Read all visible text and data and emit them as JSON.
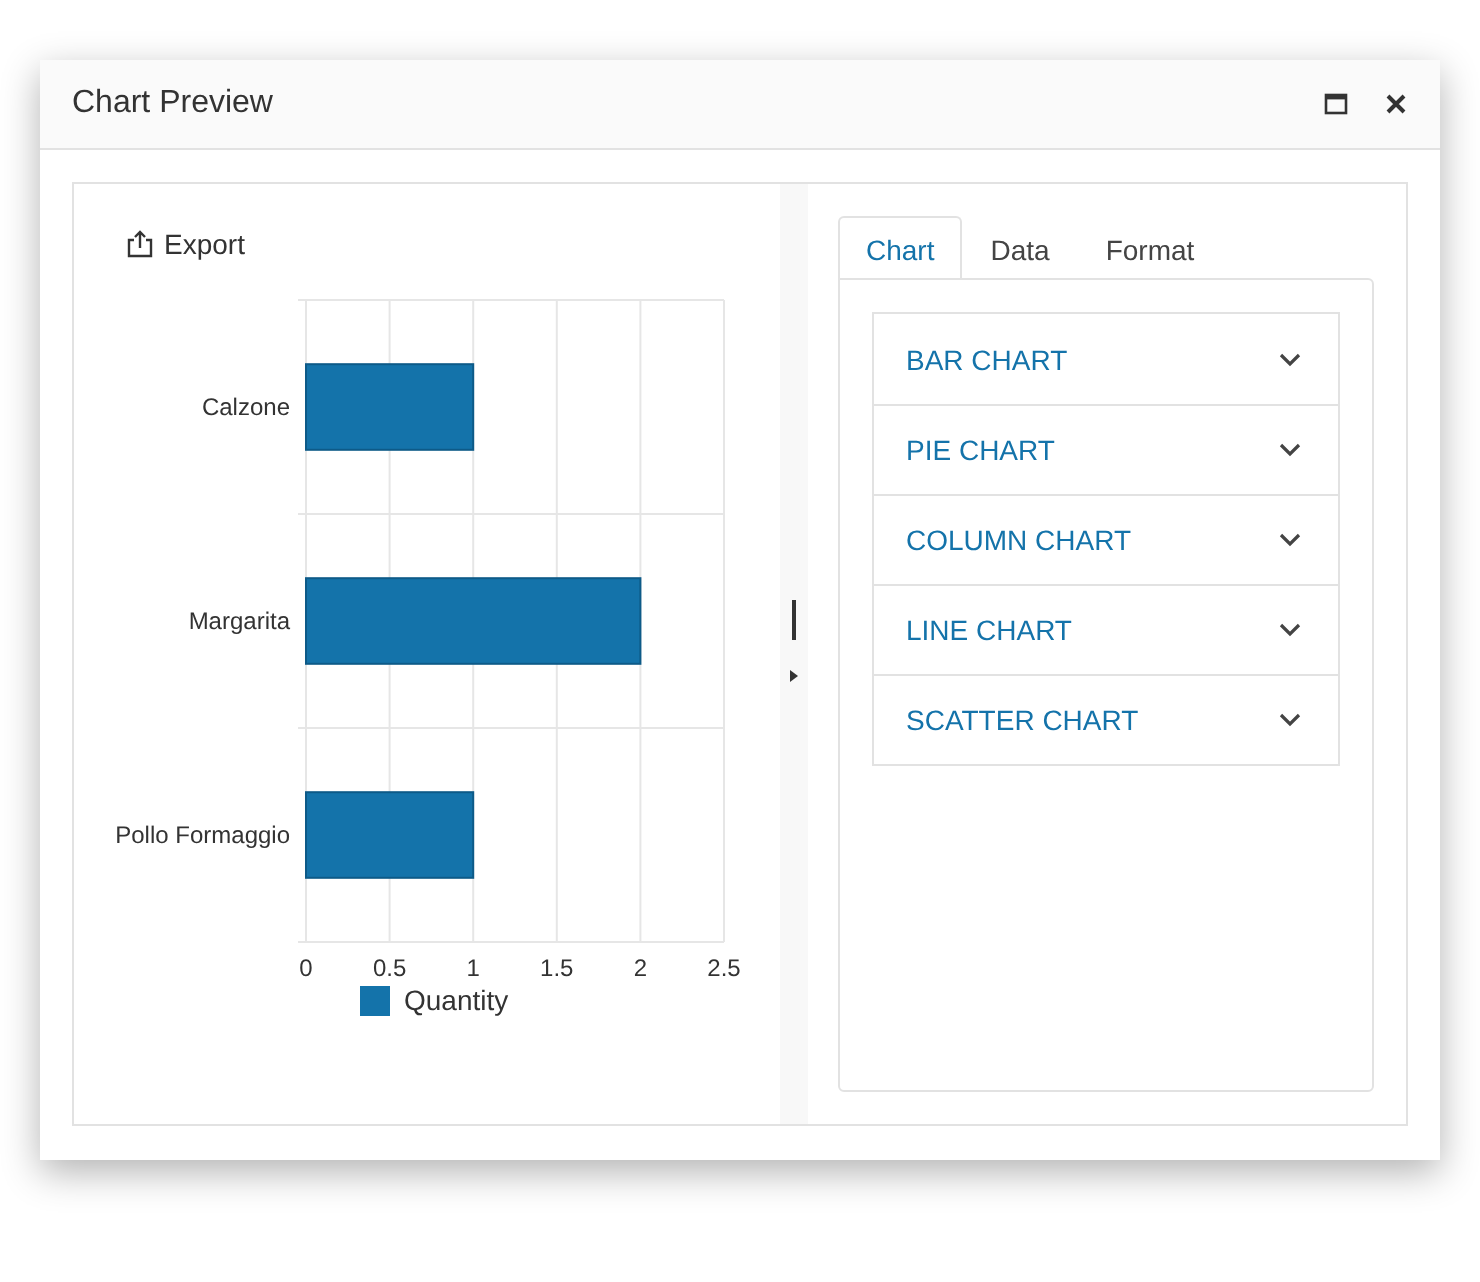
{
  "window": {
    "title": "Chart Preview"
  },
  "toolbar": {
    "export_label": "Export"
  },
  "chart": {
    "chart_data": {
      "type": "bar",
      "orientation": "horizontal",
      "grid": true,
      "categories": [
        "Calzone",
        "Margarita",
        "Pollo Formaggio"
      ],
      "series": [
        {
          "name": "Quantity",
          "color": "#1473aa",
          "values": [
            1,
            2,
            1
          ]
        }
      ],
      "xlim": [
        0,
        2.5
      ],
      "xticks": [
        {
          "value": 0,
          "label": "0"
        },
        {
          "value": 0.5,
          "label": "0.5"
        },
        {
          "value": 1,
          "label": "1"
        },
        {
          "value": 1.5,
          "label": "1.5"
        },
        {
          "value": 2,
          "label": "2"
        },
        {
          "value": 2.5,
          "label": "2.5"
        }
      ]
    }
  },
  "tabs": [
    {
      "label": "Chart",
      "selected": true
    },
    {
      "label": "Data",
      "selected": false
    },
    {
      "label": "Format",
      "selected": false
    }
  ],
  "accordion": [
    {
      "label": "BAR CHART",
      "expanded": false
    },
    {
      "label": "PIE CHART",
      "expanded": false
    },
    {
      "label": "COLUMN CHART",
      "expanded": false
    },
    {
      "label": "LINE CHART",
      "expanded": false
    },
    {
      "label": "SCATTER CHART",
      "expanded": false
    }
  ]
}
